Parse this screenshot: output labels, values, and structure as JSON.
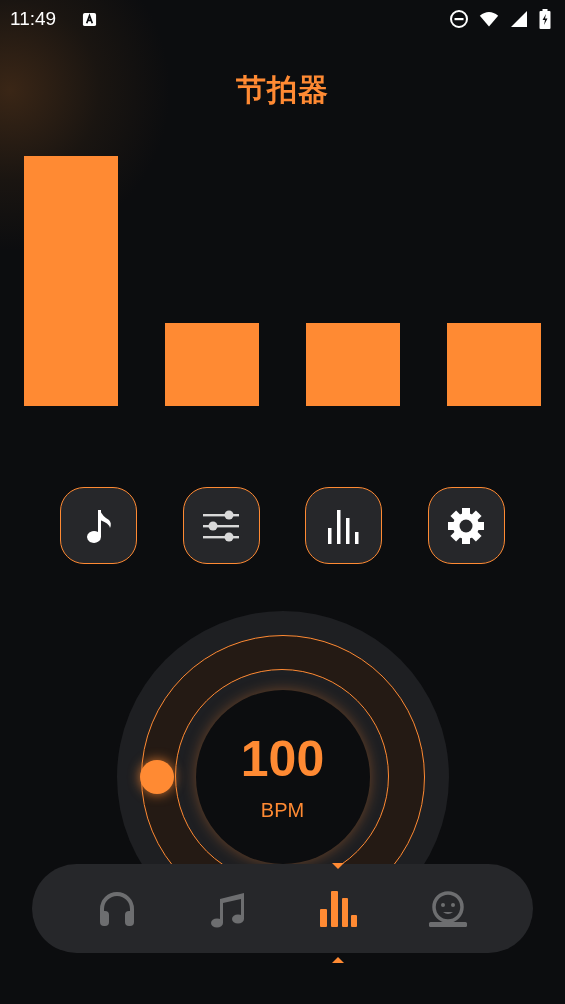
{
  "status_bar": {
    "time": "11:49"
  },
  "title": "节拍器",
  "beats": [
    {
      "accent": true
    },
    {
      "accent": false
    },
    {
      "accent": false
    },
    {
      "accent": false
    }
  ],
  "tempo": {
    "value": "100",
    "unit": "BPM"
  },
  "nav": [
    {
      "kind": "headphones",
      "selected": false
    },
    {
      "kind": "music",
      "selected": false
    },
    {
      "kind": "bars",
      "selected": true
    },
    {
      "kind": "face",
      "selected": false
    }
  ]
}
